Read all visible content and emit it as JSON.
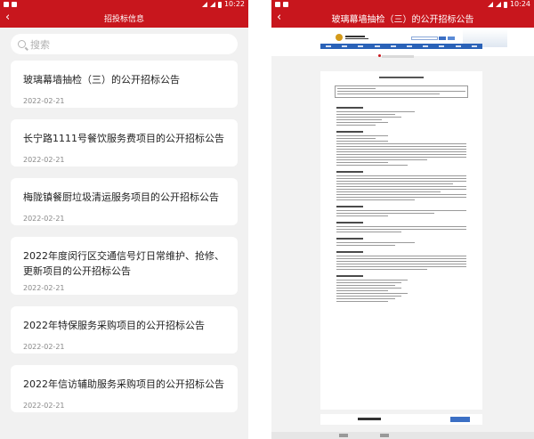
{
  "colors": {
    "accent": "#c8161d",
    "card_bg": "#ffffff",
    "date_text": "#888888",
    "web_nav": "#2a62b8"
  },
  "left": {
    "status_time": "10:22",
    "app_title": "招投标信息",
    "back_icon": "chevron-left-icon",
    "search": {
      "placeholder": "搜索",
      "icon": "search-icon"
    },
    "items": [
      {
        "title": "玻璃幕墙抽检（三）的公开招标公告",
        "date": "2022-02-21"
      },
      {
        "title": "长宁路1111号餐饮服务费项目的公开招标公告",
        "date": "2022-02-21"
      },
      {
        "title": "梅陇镇餐厨垃圾清运服务项目的公开招标公告",
        "date": "2022-02-21"
      },
      {
        "title": "2022年度闵行区交通信号灯日常维护、抢修、更新项目的公开招标公告",
        "date": "2022-02-21"
      },
      {
        "title": "2022年特保服务采购项目的公开招标公告",
        "date": "2022-02-21"
      },
      {
        "title": "2022年信访辅助服务采购项目的公开招标公告",
        "date": "2022-02-21"
      }
    ]
  },
  "right": {
    "status_time": "10:24",
    "app_title": "玻璃幕墙抽检（三）的公开招标公告",
    "back_icon": "chevron-left-icon"
  }
}
